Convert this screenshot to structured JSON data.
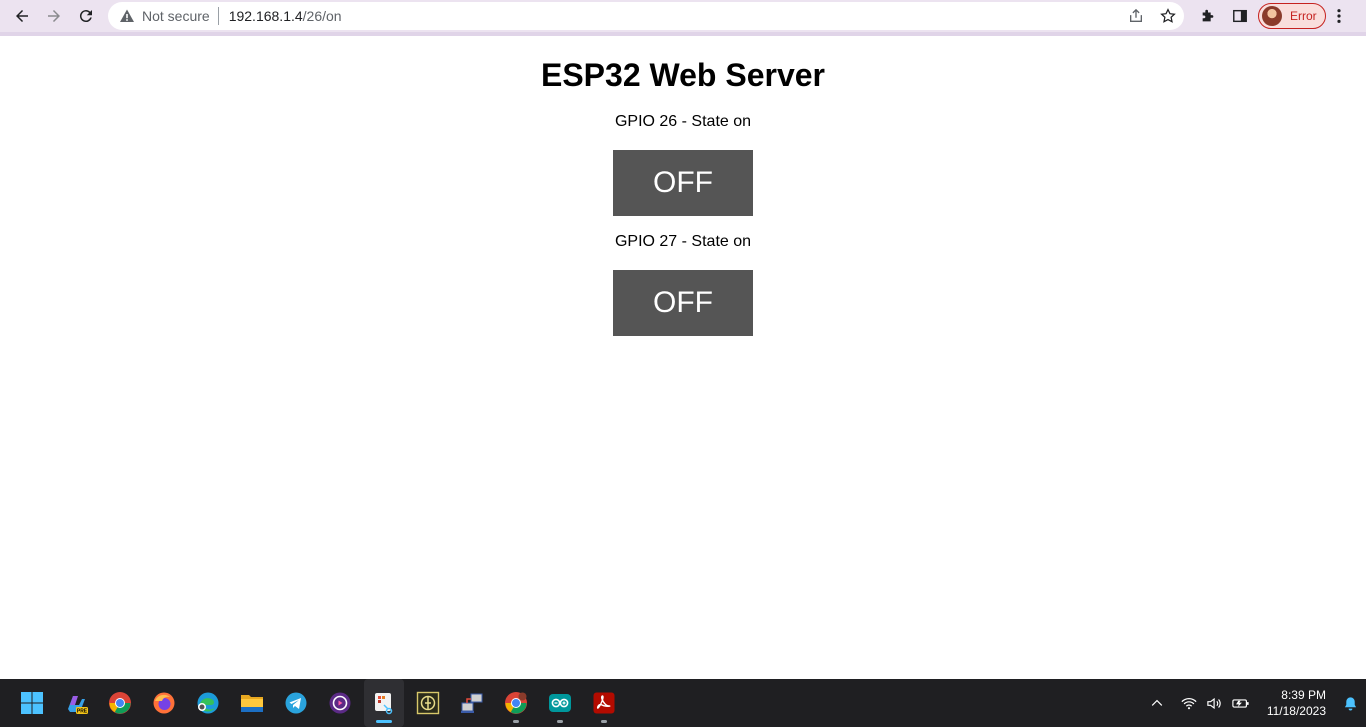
{
  "browser": {
    "security_label": "Not secure",
    "url_host": "192.168.1.4",
    "url_path": "/26/on",
    "profile_label": "Error"
  },
  "page": {
    "title": "ESP32 Web Server",
    "gpio": [
      {
        "label": "GPIO 26 - State on",
        "button": "OFF"
      },
      {
        "label": "GPIO 27 - State on",
        "button": "OFF"
      }
    ],
    "button_color": "#555555"
  },
  "taskbar": {
    "apps": [
      "start-icon",
      "copilot-pre-icon",
      "chrome-icon",
      "firefox-icon",
      "edge-icon",
      "file-explorer-icon",
      "telegram-icon",
      "media-player-icon",
      "snipping-tool-icon",
      "proteus-icon",
      "network-app-icon",
      "chrome-profile-icon",
      "arduino-icon",
      "acrobat-icon"
    ],
    "time": "8:39 PM",
    "date": "11/18/2023"
  }
}
